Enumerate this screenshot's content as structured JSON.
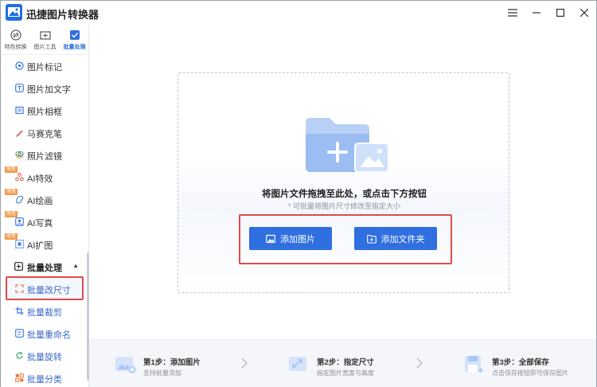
{
  "app": {
    "title": "迅捷图片转换器"
  },
  "window_controls": [
    "minimize",
    "maximize",
    "close"
  ],
  "sidebar": {
    "tabs": [
      {
        "label": "特色转换",
        "icon": "convert-icon",
        "active": false
      },
      {
        "label": "图片工具",
        "icon": "image-tool-icon",
        "active": false
      },
      {
        "label": "批量处理",
        "icon": "batch-icon",
        "active": true
      }
    ],
    "items": [
      {
        "label": "图片标记",
        "icon": "mark-icon",
        "badge": ""
      },
      {
        "label": "图片加文字",
        "icon": "text-icon",
        "badge": ""
      },
      {
        "label": "照片相框",
        "icon": "frame-icon",
        "badge": ""
      },
      {
        "label": "马赛克笔",
        "icon": "mosaic-pen-icon",
        "badge": ""
      },
      {
        "label": "照片滤镜",
        "icon": "filter-icon",
        "badge": ""
      },
      {
        "label": "AI特效",
        "icon": "ai-effect-icon",
        "badge": "限免"
      },
      {
        "label": "AI绘画",
        "icon": "ai-paint-icon",
        "badge": "限免"
      },
      {
        "label": "AI写真",
        "icon": "ai-portrait-icon",
        "badge": "限免"
      },
      {
        "label": "AI扩图",
        "icon": "ai-expand-icon",
        "badge": "限免"
      }
    ],
    "section": {
      "label": "批量处理",
      "icon": "batch-section-icon",
      "expanded": true
    },
    "batch_items": [
      {
        "label": "批量改尺寸",
        "icon": "resize-icon",
        "selected": true
      },
      {
        "label": "批量裁剪",
        "icon": "crop-icon",
        "selected": false
      },
      {
        "label": "批量重命名",
        "icon": "rename-icon",
        "selected": false
      },
      {
        "label": "批量旋转",
        "icon": "rotate-icon",
        "selected": false
      },
      {
        "label": "批量分类",
        "icon": "classify-icon",
        "selected": false
      }
    ]
  },
  "dropzone": {
    "title": "将图片文件拖拽至此处，或点击下方按钮",
    "subtitle": "* 可批量将图片尺寸修改至指定大小",
    "add_image_label": "添加图片",
    "add_folder_label": "添加文件夹"
  },
  "steps": [
    {
      "title": "第1步：添加图片",
      "desc": "支持批量添加"
    },
    {
      "title": "第2步：指定尺寸",
      "desc": "指定图片宽度与高度"
    },
    {
      "title": "第3步：全部保存",
      "desc": "点击保存按钮即可保存图片"
    }
  ],
  "colors": {
    "accent": "#2f6fe0",
    "highlight_border": "#e24a4a",
    "badge": "#f29a4c"
  }
}
